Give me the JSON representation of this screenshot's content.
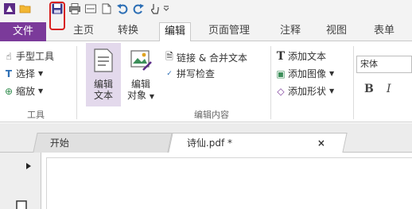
{
  "quick_access": {
    "icons": [
      "app-logo-icon",
      "open-folder-icon",
      "save-icon",
      "print-icon",
      "scan-icon",
      "new-icon",
      "undo-icon",
      "redo-icon",
      "hand-pointer-icon",
      "customize-icon"
    ],
    "highlight_color": "#d8201f"
  },
  "tabs": {
    "file": "文件",
    "home": "主页",
    "convert": "转换",
    "edit": "编辑",
    "page_manage": "页面管理",
    "comment": "注释",
    "view": "视图",
    "form": "表单",
    "active": "编辑",
    "accent_color": "#7b3a9a"
  },
  "ribbon": {
    "tools": {
      "hand": "手型工具",
      "select": "选择",
      "zoom": "缩放",
      "group_label": "工具"
    },
    "edit_content": {
      "edit_text_line1": "编辑",
      "edit_text_line2": "文本",
      "edit_object_line1": "编辑",
      "edit_object_line2": "对象",
      "link_merge": "链接 & 合并文本",
      "spell_check": "拼写检查",
      "group_label": "编辑内容"
    },
    "add": {
      "add_text": "添加文本",
      "add_image": "添加图像",
      "add_shape": "添加形状"
    },
    "format": {
      "font_name": "宋体",
      "bold": "B",
      "italic": "I"
    }
  },
  "doc_tabs": {
    "start": "开始",
    "file": "诗仙.pdf *",
    "close": "×"
  }
}
